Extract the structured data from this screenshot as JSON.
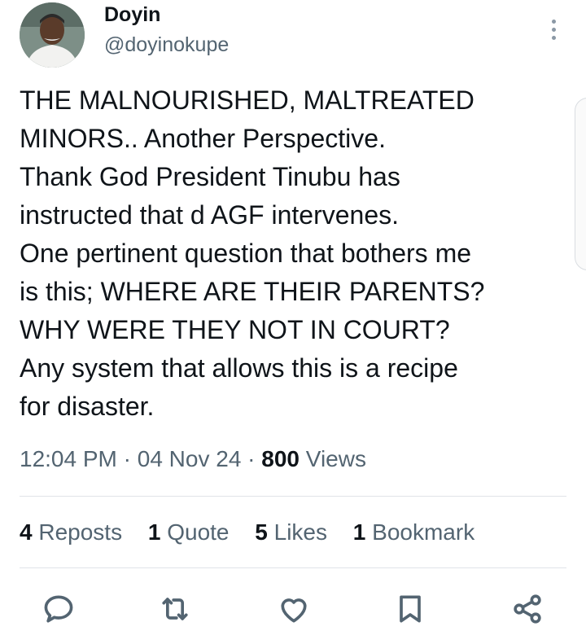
{
  "author": {
    "name": "Doyin",
    "handle": "@doyinokupe"
  },
  "post": {
    "lines": [
      "THE MALNOURISHED, MALTREATED",
      "MINORS.. Another Perspective.",
      "Thank God President Tinubu has",
      "instructed that d AGF intervenes.",
      "One pertinent question that bothers me",
      "is this; WHERE ARE THEIR PARENTS?",
      "WHY WERE THEY NOT IN COURT?",
      "Any system that allows this is a recipe",
      "for disaster."
    ]
  },
  "meta": {
    "time": "12:04 PM",
    "date": "04 Nov 24",
    "views_count": "800",
    "views_label": "Views",
    "separator": "·"
  },
  "stats": {
    "reposts": {
      "count": "4",
      "label": "Reposts"
    },
    "quotes": {
      "count": "1",
      "label": "Quote"
    },
    "likes": {
      "count": "5",
      "label": "Likes"
    },
    "bookmarks": {
      "count": "1",
      "label": "Bookmark"
    }
  },
  "actions": [
    "reply-icon",
    "repost-icon",
    "like-icon",
    "bookmark-icon",
    "share-icon"
  ],
  "colors": {
    "text": "#0f1419",
    "secondary": "#536471",
    "divider": "#e1e4e8",
    "icon": "#536471"
  }
}
